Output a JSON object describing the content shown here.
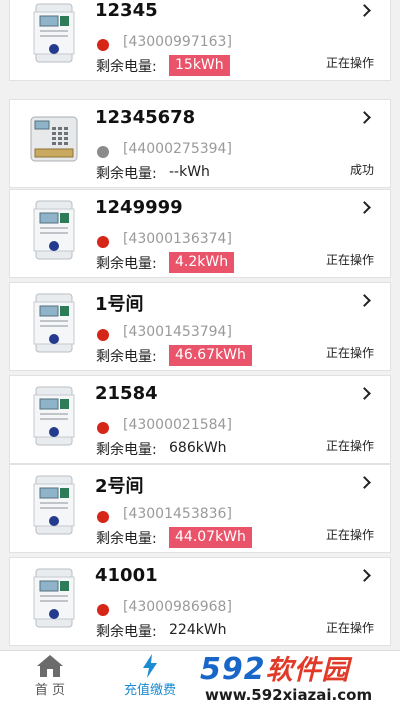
{
  "balance_label": "剩余电量:",
  "meters": [
    {
      "name": "12345",
      "meter_id": "[43000997163]",
      "balance": "15kWh",
      "low": true,
      "dot_color": "#d62617",
      "status": "正在操作",
      "device": "din"
    },
    {
      "name": "12345678",
      "meter_id": "[44000275394]",
      "balance": "--kWh",
      "low": false,
      "dot_color": "#8a8a8a",
      "status": "成功",
      "device": "keypad"
    },
    {
      "name": "1249999",
      "meter_id": "[43000136374]",
      "balance": "4.2kWh",
      "low": true,
      "dot_color": "#d62617",
      "status": "正在操作",
      "device": "din"
    },
    {
      "name": "1号间",
      "meter_id": "[43001453794]",
      "balance": "46.67kWh",
      "low": true,
      "dot_color": "#d62617",
      "status": "正在操作",
      "device": "din"
    },
    {
      "name": "21584",
      "meter_id": "[43000021584]",
      "balance": "686kWh",
      "low": false,
      "dot_color": "#d62617",
      "status": "正在操作",
      "device": "din"
    },
    {
      "name": "2号间",
      "meter_id": "[43001453836]",
      "balance": "44.07kWh",
      "low": true,
      "dot_color": "#d62617",
      "status": "正在操作",
      "device": "din"
    },
    {
      "name": "41001",
      "meter_id": "[43000986968]",
      "balance": "224kWh",
      "low": false,
      "dot_color": "#d62617",
      "status": "正在操作",
      "device": "din"
    }
  ],
  "tabbar": {
    "home_label": "首 页",
    "recharge_label": "充值缴费",
    "active_color": "#1b8bd2"
  },
  "watermark": {
    "logo_num": "592",
    "logo_cn": "软件园",
    "url": "www.592xiazai.com"
  }
}
